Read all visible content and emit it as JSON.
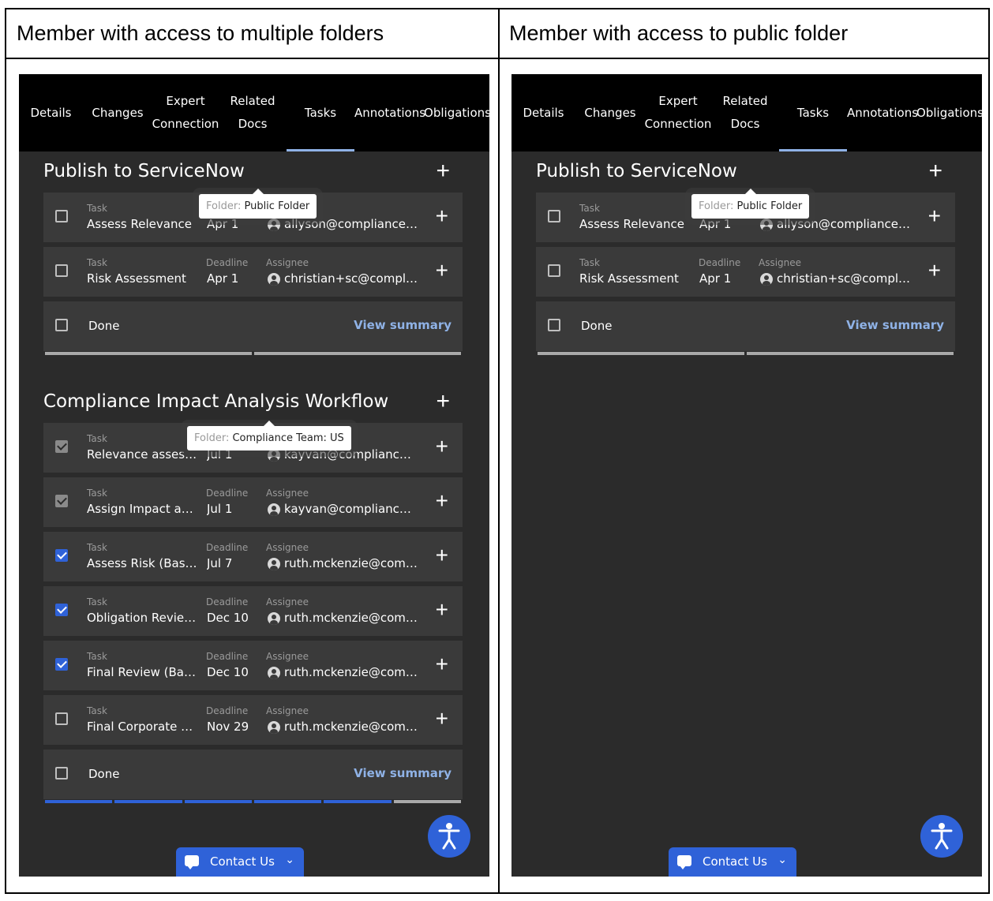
{
  "headings": {
    "left": "Member with access to multiple folders",
    "right": "Member with access to public folder"
  },
  "tabs": [
    {
      "label": "Details"
    },
    {
      "label": "Changes"
    },
    {
      "label": "Expert\nConnection"
    },
    {
      "label": "Related\nDocs"
    },
    {
      "label": "Tasks",
      "active": true
    },
    {
      "label": "Annotations"
    },
    {
      "label": "Obligations"
    }
  ],
  "labels": {
    "task": "Task",
    "deadline": "Deadline",
    "assignee": "Assignee",
    "done": "Done",
    "view_summary": "View summary",
    "folder_prefix": "Folder:",
    "contact_us": "Contact Us"
  },
  "workflow_servicenow": {
    "title": "Publish to ServiceNow",
    "tooltip_folder": "Public Folder",
    "tasks": [
      {
        "name": "Assess Relevance",
        "deadline": "Apr 1",
        "assignee": "allyson@compliance.ai",
        "checked": "none"
      },
      {
        "name": "Risk Assessment",
        "deadline": "Apr 1",
        "assignee": "christian+sc@compli…",
        "checked": "none"
      }
    ],
    "progress": [
      "grey",
      "grey"
    ]
  },
  "workflow_cia": {
    "title": "Compliance Impact Analysis Workflow",
    "tooltip_folder": "Compliance Team: US",
    "tasks": [
      {
        "name": "Relevance assess…",
        "deadline": "Jul 1",
        "assignee": "kayvan@compliance.ai",
        "checked": "grey"
      },
      {
        "name": "Assign Impact an…",
        "deadline": "Jul 1",
        "assignee": "kayvan@compliance.ai",
        "checked": "grey"
      },
      {
        "name": "Assess Risk (Base…",
        "deadline": "Jul 7",
        "assignee": "ruth.mckenzie@com…",
        "checked": "blue"
      },
      {
        "name": "Obligation Revie…",
        "deadline": "Dec 10",
        "assignee": "ruth.mckenzie@com…",
        "checked": "blue"
      },
      {
        "name": "Final Review (Bas…",
        "deadline": "Dec 10",
        "assignee": "ruth.mckenzie@com…",
        "checked": "blue"
      },
      {
        "name": "Final Corporate R…",
        "deadline": "Nov 29",
        "assignee": "ruth.mckenzie@com…",
        "checked": "none"
      }
    ],
    "progress": [
      "blue",
      "blue",
      "blue",
      "blue",
      "blue",
      "grey"
    ]
  },
  "colors": {
    "panel_bg": "#2b2b2b",
    "row_bg": "#3a3a3a",
    "accent_blue": "#2f62d8",
    "link_blue": "#8fb2e6"
  },
  "icons": {
    "add": "plus-icon",
    "assignee": "user-avatar-icon",
    "accessibility": "accessibility-icon",
    "chat": "chat-icon",
    "chevron": "chevron-down-icon"
  }
}
